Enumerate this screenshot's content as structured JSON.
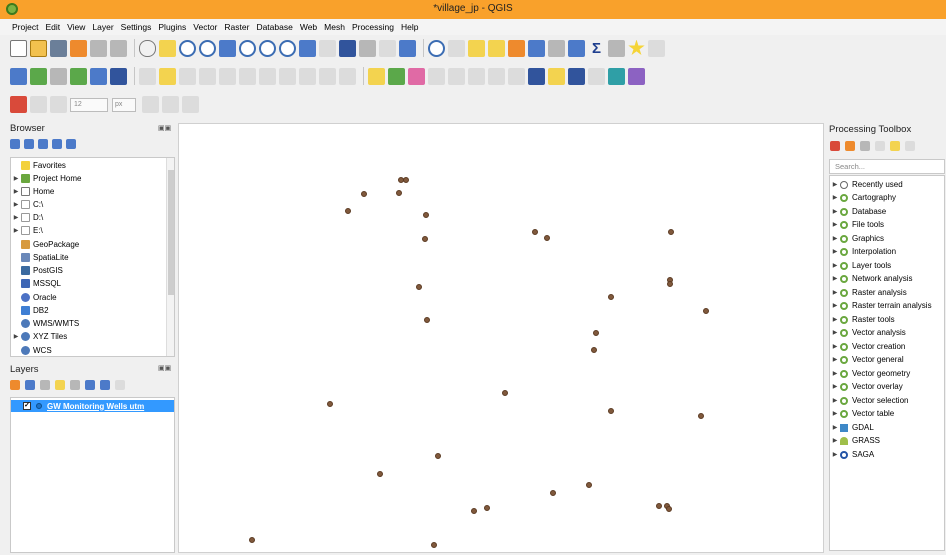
{
  "window": {
    "title": "*village_jp - QGIS"
  },
  "menu": [
    "Project",
    "Edit",
    "View",
    "Layer",
    "Settings",
    "Plugins",
    "Vector",
    "Raster",
    "Database",
    "Web",
    "Mesh",
    "Processing",
    "Help"
  ],
  "digitizing": {
    "size_value": "12",
    "unit_value": "px"
  },
  "browser": {
    "title": "Browser",
    "items": [
      "Favorites",
      "Project Home",
      "Home",
      "C:\\",
      "D:\\",
      "E:\\",
      "GeoPackage",
      "SpatiaLite",
      "PostGIS",
      "MSSQL",
      "Oracle",
      "DB2",
      "WMS/WMTS",
      "XYZ Tiles",
      "WCS"
    ]
  },
  "layers": {
    "title": "Layers",
    "items": [
      {
        "name": "GW Monitoring Wells utm",
        "checked": true
      }
    ]
  },
  "toolbox": {
    "title": "Processing Toolbox",
    "search_placeholder": "Search...",
    "items": [
      "Recently used",
      "Cartography",
      "Database",
      "File tools",
      "Graphics",
      "Interpolation",
      "Layer tools",
      "Network analysis",
      "Raster analysis",
      "Raster terrain analysis",
      "Raster tools",
      "Vector analysis",
      "Vector creation",
      "Vector general",
      "Vector geometry",
      "Vector overlay",
      "Vector selection",
      "Vector table",
      "GDAL",
      "GRASS",
      "SAGA"
    ]
  },
  "colors": {
    "titlebar": "#f9a12b",
    "selection": "#3399ff",
    "well_point": "#80593c"
  }
}
